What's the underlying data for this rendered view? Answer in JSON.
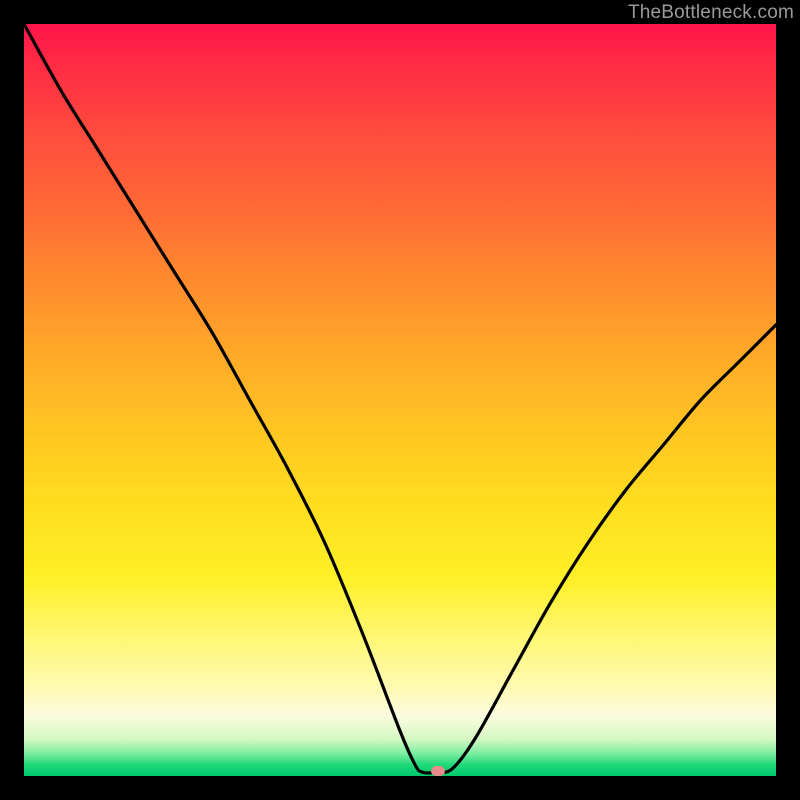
{
  "watermark": "TheBottleneck.com",
  "marker": {
    "color_hex": "#e68a8a"
  },
  "chart_data": {
    "type": "line",
    "title": "",
    "xlabel": "",
    "ylabel": "",
    "xlim": [
      0,
      100
    ],
    "ylim": [
      0,
      100
    ],
    "grid": false,
    "legend": false,
    "note": "Unlabeled V-shaped bottleneck curve over a color heat gradient. Values estimated from pixel positions; x = horizontal percent of plot, y = 0 at bottom (green) to 100 at top (red).",
    "series": [
      {
        "name": "bottleneck-curve",
        "x": [
          0,
          5,
          10,
          15,
          20,
          25,
          30,
          35,
          40,
          45,
          50,
          52,
          53,
          55,
          57,
          60,
          65,
          70,
          75,
          80,
          85,
          90,
          95,
          100
        ],
        "y": [
          100,
          91,
          83,
          75,
          67,
          59,
          50,
          41,
          31,
          19,
          6,
          1.5,
          0.5,
          0.5,
          1,
          5,
          14,
          23,
          31,
          38,
          44,
          50,
          55,
          60
        ]
      }
    ],
    "marker_point": {
      "x": 55,
      "y": 0.5
    },
    "gradient_bands_top_to_bottom": [
      "red",
      "orange",
      "yellow",
      "pale-yellow",
      "pale-green",
      "green"
    ]
  }
}
